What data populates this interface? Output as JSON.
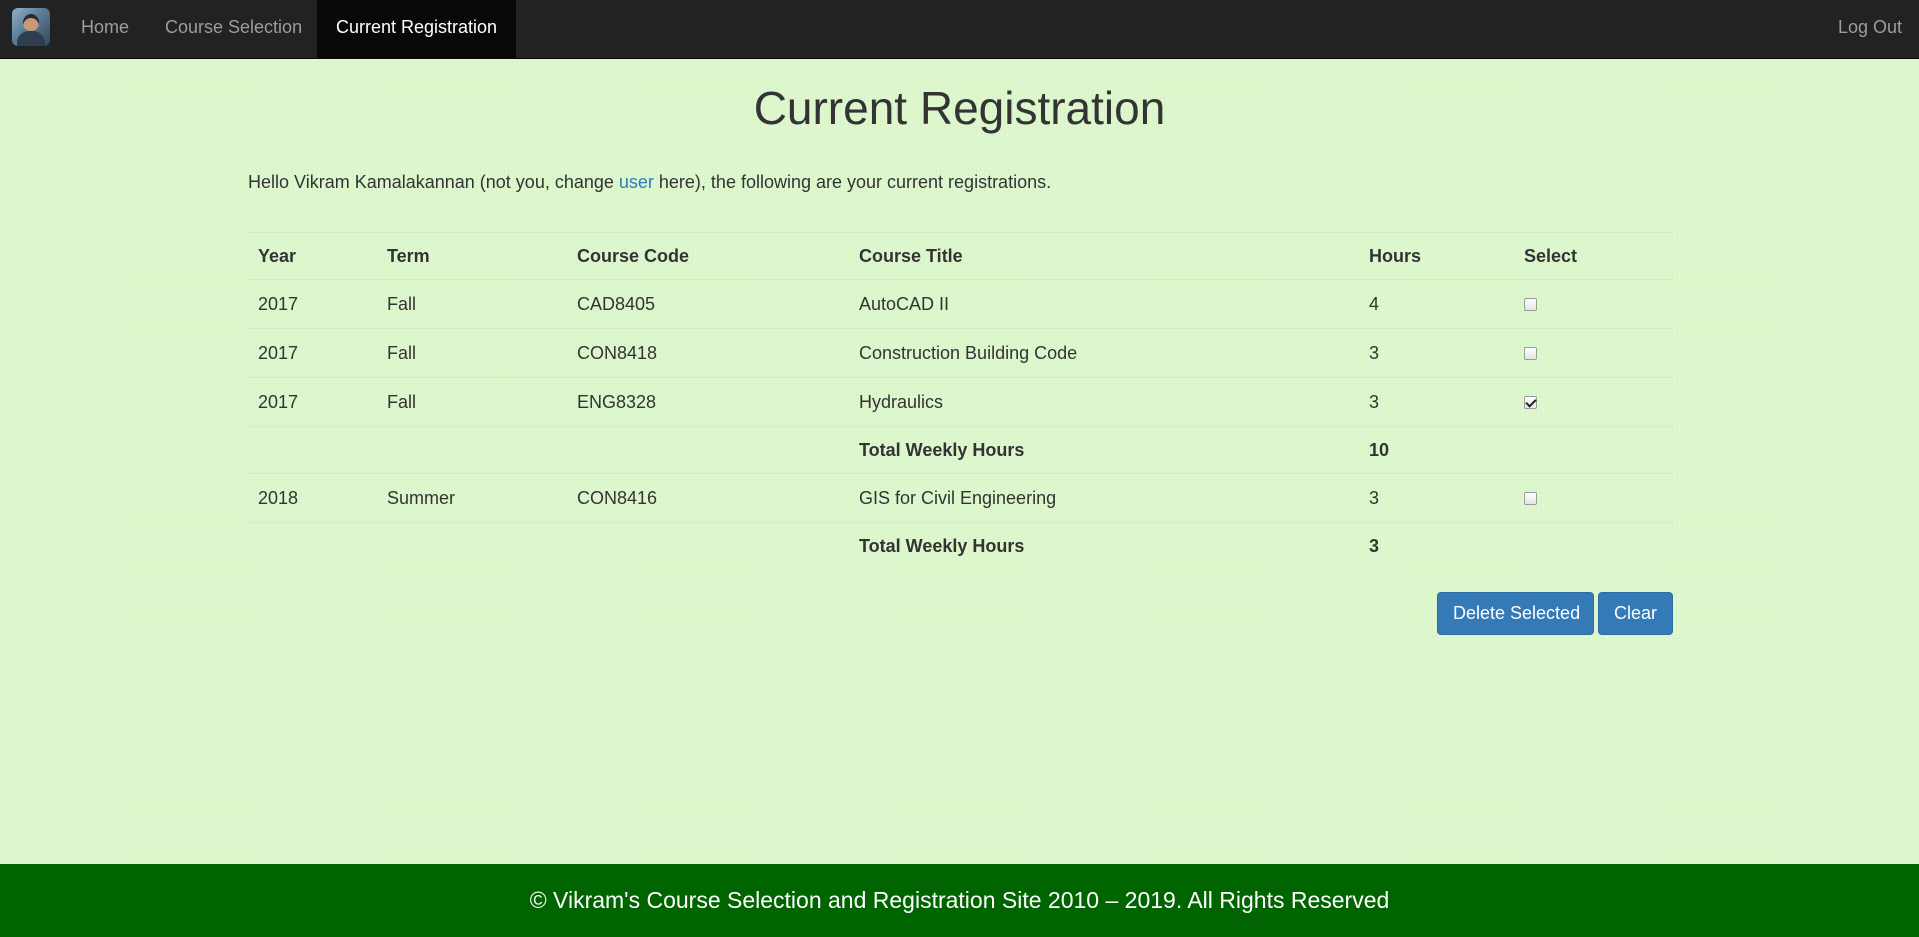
{
  "nav": {
    "items": [
      {
        "label": "Home"
      },
      {
        "label": "Course Selection"
      },
      {
        "label": "Current Registration"
      }
    ],
    "logout_label": "Log Out",
    "logo_icon": "user-avatar-logo"
  },
  "page": {
    "title": "Current Registration",
    "greeting_prefix": "Hello Vikram Kamalakannan (not you, change ",
    "greeting_link": "user",
    "greeting_suffix": " here), the following are your current registrations."
  },
  "table": {
    "headers": [
      "Year",
      "Term",
      "Course Code",
      "Course Title",
      "Hours",
      "Select"
    ],
    "rows": [
      {
        "year": "2017",
        "term": "Fall",
        "code": "CAD8405",
        "title": "AutoCAD II",
        "hours": "4",
        "selected": false
      },
      {
        "year": "2017",
        "term": "Fall",
        "code": "CON8418",
        "title": "Construction Building Code",
        "hours": "3",
        "selected": false
      },
      {
        "year": "2017",
        "term": "Fall",
        "code": "ENG8328",
        "title": "Hydraulics",
        "hours": "3",
        "selected": true
      }
    ],
    "total_1": {
      "label": "Total Weekly Hours",
      "value": "10"
    },
    "rows_2": [
      {
        "year": "2018",
        "term": "Summer",
        "code": "CON8416",
        "title": "GIS for Civil Engineering",
        "hours": "3",
        "selected": false
      }
    ],
    "total_2": {
      "label": "Total Weekly Hours",
      "value": "3"
    }
  },
  "buttons": {
    "delete_label": "Delete Selected",
    "clear_label": "Clear"
  },
  "footer": {
    "text": "© Vikram's Course Selection and Registration Site 2010 – 2019. All Rights Reserved"
  },
  "colors": {
    "navbar": "#222222",
    "background": "#dcf7cc",
    "footer": "#006400",
    "primary_button": "#337ab7",
    "link": "#337ab7"
  }
}
